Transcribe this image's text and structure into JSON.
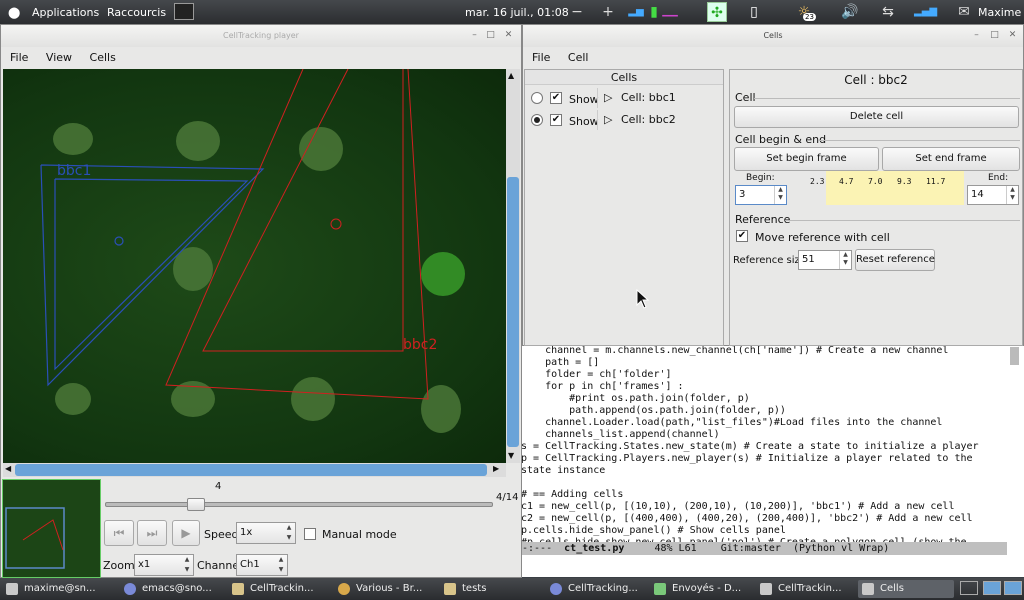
{
  "top_panel": {
    "applications": "Applications",
    "shortcuts": "Raccourcis",
    "datetime": "mar. 16 juil., 01:08",
    "calendar_day": "23",
    "user": "Maxime"
  },
  "player": {
    "title": "CellTracking player",
    "menu": [
      "File",
      "View",
      "Cells"
    ],
    "cell_label_1": "bbc1",
    "cell_label_2": "bbc2",
    "frame_number": "4",
    "frame_counter": "4/14",
    "speed_label": "Speed:",
    "speed_value": "1x",
    "manual_mode": "Manual mode",
    "zoom_label": "Zoom:",
    "zoom_value": "x1",
    "channel_label": "Channel:",
    "channel_value": "Ch1",
    "progress": 0.21
  },
  "cells_window": {
    "title": "Cells",
    "menu": [
      "File",
      "Cell"
    ],
    "list_header": "Cells",
    "rows": [
      {
        "show": "Show",
        "name": "Cell: bbc1",
        "selected": false
      },
      {
        "show": "Show",
        "name": "Cell: bbc2",
        "selected": true
      }
    ],
    "panel_title": "Cell : bbc2",
    "cell_group": "Cell",
    "delete_button": "Delete cell",
    "begin_end_group": "Cell begin & end",
    "set_begin": "Set begin frame",
    "set_end": "Set end frame",
    "begin_label": "Begin:",
    "end_label": "End:",
    "begin_value": "3",
    "end_value": "14",
    "ruler_ticks": [
      "2.3",
      "4.7",
      "7.0",
      "9.3",
      "11.7"
    ],
    "reference_group": "Reference",
    "move_reference": "Move reference with cell",
    "reference_size_label": "Reference size",
    "reference_size_value": "51",
    "reset_reference": "Reset reference"
  },
  "emacs": {
    "lines": [
      "    channel = m.channels.new_channel(ch['name']) # Create a new channel",
      "    path = []",
      "    folder = ch['folder']",
      "    for p in ch['frames'] :",
      "        #print os.path.join(folder, p)",
      "        path.append(os.path.join(folder, p))",
      "    channel.Loader.load(path,\"list_files\")#Load files into the channel",
      "    channels_list.append(channel)",
      "s = CellTracking.States.new_state(m) # Create a state to initialize a player",
      "p = CellTracking.Players.new_player(s) # Initialize a player related to the",
      "state instance",
      "",
      "# == Adding cells",
      "c1 = new_cell(p, [(10,10), (200,10), (10,200)], 'bbc1') # Add a new cell",
      "c2 = new_cell(p, [(400,400), (400,20), (200,400)], 'bbc2') # Add a new cell",
      "p.cells.hide_show_panel() # Show cells panel",
      "#p.cells.hide_show_new_cell_panel('pol') # Create a polygon cell (show the"
    ],
    "modeline_prefix": "-:---  ",
    "modeline_file": "ct_test.py",
    "modeline_rest": "     48% L61    Git:master  (Python vl Wrap)"
  },
  "taskbar": {
    "items": [
      "maxime@sn...",
      "emacs@sno...",
      "CellTrackin...",
      "Various - Br...",
      "tests",
      "CellTracking...",
      "Envoyés - D...",
      "CellTrackin...",
      "Cells"
    ]
  }
}
